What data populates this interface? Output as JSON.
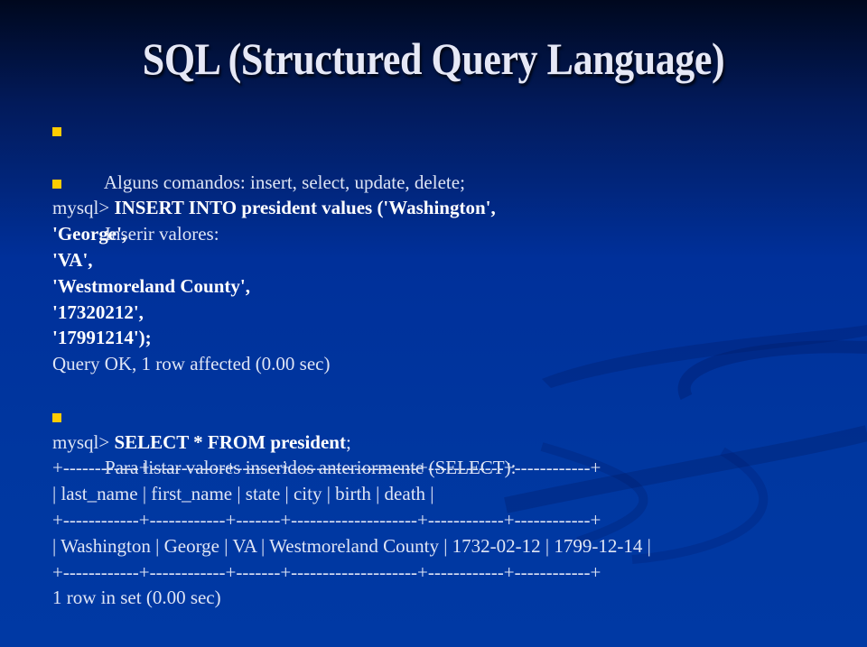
{
  "slide": {
    "title": "SQL (Structured Query Language)",
    "bullet_color": "#ffcc00",
    "bullets": [
      {
        "text": "Alguns comandos: insert, select, update, delete;"
      },
      {
        "text": "Inserir valores:"
      },
      {
        "text": "Para listar valores inseridos anteriormente (SELECT):"
      }
    ],
    "insert": {
      "prompt": "mysql> ",
      "command": "INSERT INTO president values ('Washington',",
      "values": [
        "'George',",
        "'VA',",
        "'Westmoreland County',",
        "'17320212',",
        "'17991214');"
      ],
      "result": "Query OK, 1 row affected (0.00 sec)"
    },
    "select": {
      "prompt": "mysql> ",
      "command": "SELECT * FROM president",
      "terminator": ";",
      "separator": "+------------+------------+-------+--------------------+------------+------------+",
      "header_row": "| last_name | first_name | state | city | birth | death |",
      "data_row": "| Washington | George | VA | Westmoreland County | 1732-02-12 | 1799-12-14 |",
      "columns": [
        "last_name",
        "first_name",
        "state",
        "city",
        "birth",
        "death"
      ],
      "rows": [
        [
          "Washington",
          "George",
          "VA",
          "Westmoreland County",
          "1732-02-12",
          "1799-12-14"
        ]
      ],
      "result": "1 row in set (0.00 sec)"
    }
  }
}
